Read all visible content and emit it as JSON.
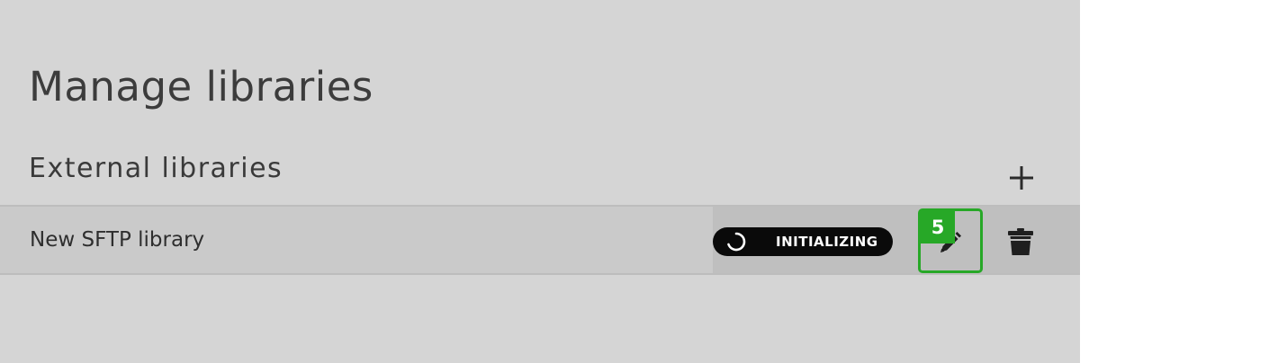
{
  "page": {
    "title": "Manage libraries"
  },
  "section": {
    "title": "External libraries",
    "add_icon": "plus-icon"
  },
  "libraries": [
    {
      "name": "New SFTP library",
      "status": "INITIALIZING",
      "status_icon": "spinner-icon",
      "edit_icon": "pencil-icon",
      "delete_icon": "trash-icon",
      "edit_badge": "5"
    }
  ],
  "colors": {
    "panel_background": "#d5d5d5",
    "row_background": "#cacaca",
    "status_pill": "#0a0a0a",
    "highlight_green": "#27a827"
  }
}
